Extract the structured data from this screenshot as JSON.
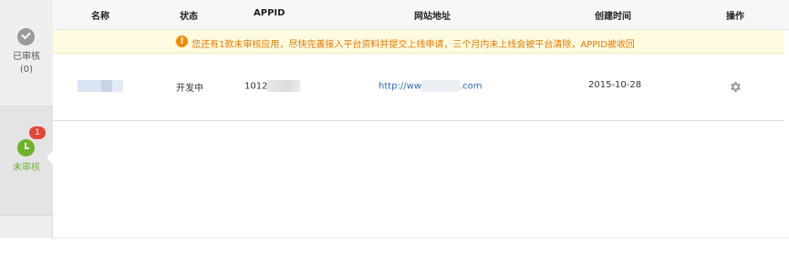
{
  "sidebar": {
    "approved": {
      "label": "已审核",
      "count": "(0)",
      "icon": "check-circle-icon"
    },
    "pending": {
      "label": "未审核",
      "badge": "1",
      "icon": "clock-icon"
    }
  },
  "table": {
    "columns": [
      "名称",
      "状态",
      "APPID",
      "网站地址",
      "创建时间",
      "操作"
    ],
    "notice": "您还有1款未审核应用，尽快完善接入平台资料并提交上线申请，三个月内未上线会被平台清除，APPID被收回",
    "rows": [
      {
        "status": "开发中",
        "appid_prefix": "1012",
        "url_prefix": "http://ww",
        "url_suffix": ".com",
        "created": "2015-10-28",
        "action_icon": "gear-icon"
      }
    ]
  },
  "colors": {
    "accent_green": "#6eb32b",
    "badge_red": "#e2483a",
    "notice_orange": "#e37800",
    "link_blue": "#2b6cb0"
  }
}
